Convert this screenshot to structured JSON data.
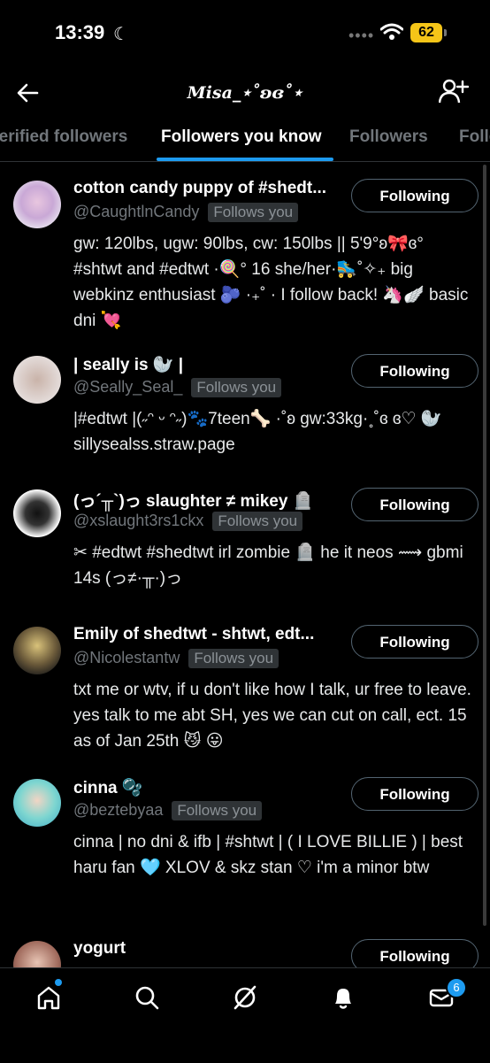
{
  "status_bar": {
    "time": "13:39",
    "battery": "62"
  },
  "header": {
    "title": "Misa_⋆˚ʚɞ˚⋆"
  },
  "tabs": [
    {
      "label": "Verified followers"
    },
    {
      "label": "Followers you know"
    },
    {
      "label": "Followers"
    },
    {
      "label": "Following"
    }
  ],
  "users": [
    {
      "name": "cotton candy puppy of #shedt...",
      "handle": "@CaughtlnCandy",
      "follows_label": "Follows you",
      "button": "Following",
      "bio": "gw: 120lbs, ugw: 90lbs, cw: 150lbs || 5'9°ʚ🎀ɞ° #shtwt and #edtwt ·🍭° 16 she/her·🛼˚✧₊ big webkinz enthusiast 🫐 ·₊˚ · I follow back! 🦄🪽 basic dni 💘"
    },
    {
      "name": "| seally is 🦭 |",
      "handle": "@Seally_Seal_",
      "follows_label": "Follows you",
      "button": "Following",
      "bio": "|#edtwt |(˶ᵔ ᵕ ᵔ˶)🐾7teen🦴 ·˚ʚ gw:33kg·˳˚ɞ ɞ♡ 🦭 sillysealss.straw.page"
    },
    {
      "name": "(っ´╥`)っ slaughter ≠ mikey 🪦",
      "handle": "@xslaught3rs1ckx",
      "follows_label": "Follows you",
      "button": "Following",
      "bio": "✂ #edtwt #shedtwt irl zombie 🪦 he it neos ⟿ gbmi 14s (っ≠·╥·)っ"
    },
    {
      "name": "Emily of shedtwt - shtwt, edt...",
      "handle": "@Nicolestantw",
      "follows_label": "Follows you",
      "button": "Following",
      "bio": "txt me or wtv, if u don't like how I talk, ur free to leave. yes talk to me abt SH, yes we can cut on call, ect. 15 as of Jan 25th 😼 😛"
    },
    {
      "name": "cinna 🫧",
      "handle": "@beztebyaa",
      "follows_label": "Follows you",
      "button": "Following",
      "bio": "cinna | no dni & ifb | #shtwt | ( I LOVE BILLIE ) | best haru fan 🩵 XLOV & skz stan ♡ i'm a minor btw"
    },
    {
      "name": "yogurt",
      "handle": "",
      "follows_label": "",
      "button": "Following",
      "bio": ""
    }
  ],
  "bottom_nav": {
    "messages_badge": "6"
  }
}
